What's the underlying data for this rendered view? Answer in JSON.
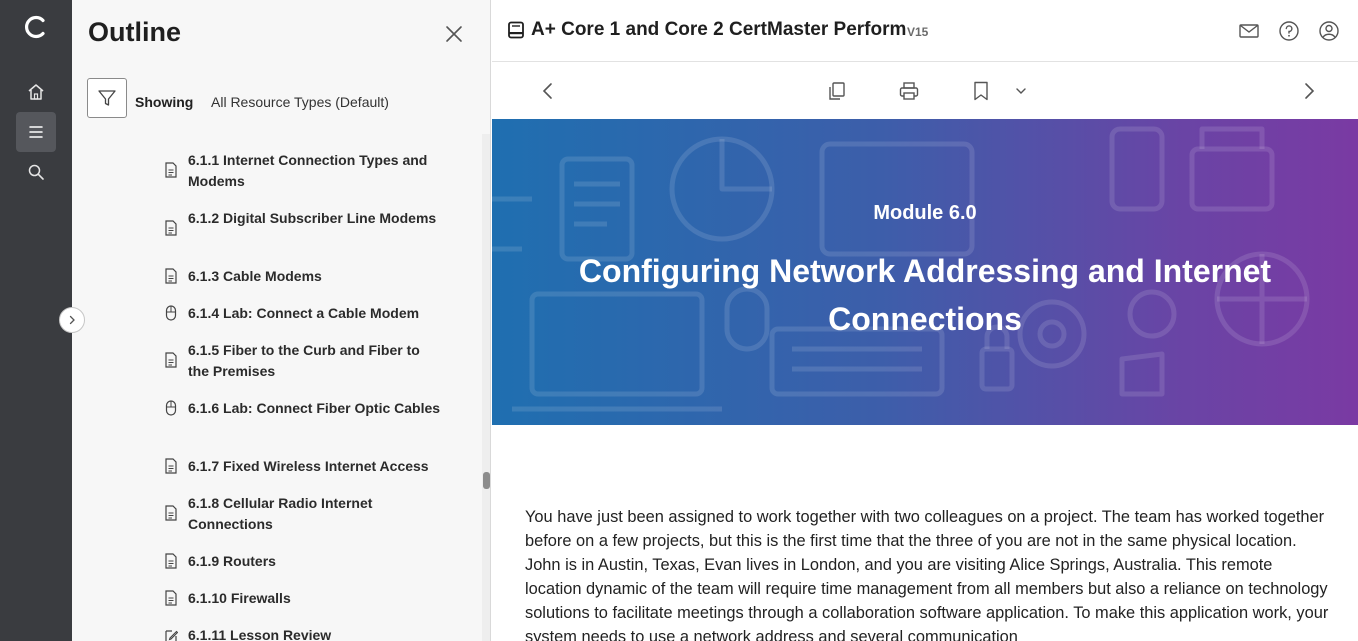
{
  "outline": {
    "title": "Outline",
    "showing_label": "Showing",
    "showing_value": "All Resource Types (Default)",
    "items": [
      {
        "label": "6.1.1 Internet Connection Types and Modems",
        "icon": "document-icon"
      },
      {
        "label": "6.1.2 Digital Subscriber Line Modems",
        "icon": "document-icon"
      },
      {
        "label": "6.1.3 Cable Modems",
        "icon": "document-icon"
      },
      {
        "label": "6.1.4 Lab: Connect a Cable Modem",
        "icon": "mouse-icon"
      },
      {
        "label": "6.1.5 Fiber to the Curb and Fiber to the Premises",
        "icon": "document-icon"
      },
      {
        "label": "6.1.6 Lab: Connect Fiber Optic Cables",
        "icon": "mouse-icon"
      },
      {
        "label": "6.1.7 Fixed Wireless Internet Access",
        "icon": "document-icon"
      },
      {
        "label": "6.1.8 Cellular Radio Internet Connections",
        "icon": "document-icon"
      },
      {
        "label": "6.1.9 Routers",
        "icon": "document-icon"
      },
      {
        "label": "6.1.10 Firewalls",
        "icon": "document-icon"
      },
      {
        "label": "6.1.11 Lesson Review",
        "icon": "edit-icon"
      }
    ]
  },
  "header": {
    "course_title": "A+ Core 1 and Core 2 CertMaster Perform",
    "version": "V15"
  },
  "banner": {
    "module_label": "Module 6.0",
    "module_title": "Configuring Network Addressing and Internet Connections"
  },
  "content": {
    "intro": "You have just been assigned to work together with two colleagues on a project. The team has worked together before on a few projects, but this is the first time that the three of you are not in the same physical location. John is in Austin, Texas, Evan lives in London, and you are visiting Alice Springs, Australia. This remote location dynamic of the team will require time management from all members but also a reliance on technology solutions to facilitate meetings through a collaboration software application. To make this application work, your system needs to use a network address and several communication"
  },
  "colors": {
    "rail": "#3a3c40",
    "panel": "#f7f7f7",
    "banner_start": "#1f6fb0",
    "banner_end": "#7a3aa3"
  }
}
